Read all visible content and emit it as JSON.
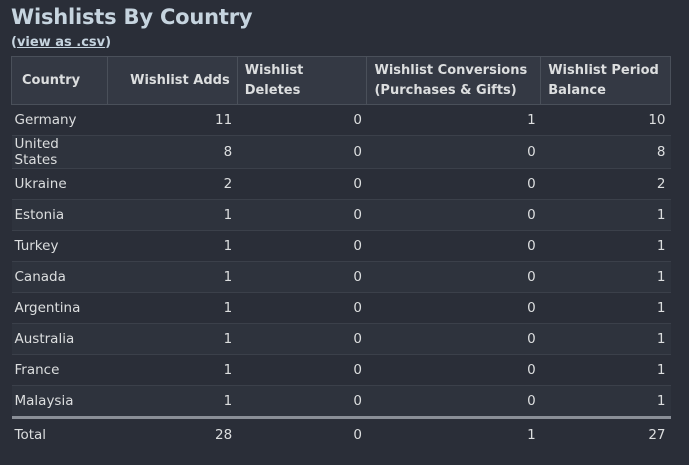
{
  "page": {
    "title": "Wishlists By Country",
    "csv_prefix": "(",
    "csv_link": "view as .csv",
    "csv_suffix": ")"
  },
  "table": {
    "headers": {
      "country": "Country",
      "adds": "Wishlist Adds",
      "deletes": "Wishlist Deletes",
      "conversions_line1": "Wishlist Conversions",
      "conversions_line2": "(Purchases & Gifts)",
      "balance_line1": "Wishlist Period",
      "balance_line2": "Balance"
    },
    "rows": [
      {
        "country": "Germany",
        "adds": "11",
        "deletes": "0",
        "conversions": "1",
        "balance": "10"
      },
      {
        "country": "United States",
        "adds": "8",
        "deletes": "0",
        "conversions": "0",
        "balance": "8"
      },
      {
        "country": "Ukraine",
        "adds": "2",
        "deletes": "0",
        "conversions": "0",
        "balance": "2"
      },
      {
        "country": "Estonia",
        "adds": "1",
        "deletes": "0",
        "conversions": "0",
        "balance": "1"
      },
      {
        "country": "Turkey",
        "adds": "1",
        "deletes": "0",
        "conversions": "0",
        "balance": "1"
      },
      {
        "country": "Canada",
        "adds": "1",
        "deletes": "0",
        "conversions": "0",
        "balance": "1"
      },
      {
        "country": "Argentina",
        "adds": "1",
        "deletes": "0",
        "conversions": "0",
        "balance": "1"
      },
      {
        "country": "Australia",
        "adds": "1",
        "deletes": "0",
        "conversions": "0",
        "balance": "1"
      },
      {
        "country": "France",
        "adds": "1",
        "deletes": "0",
        "conversions": "0",
        "balance": "1"
      },
      {
        "country": "Malaysia",
        "adds": "1",
        "deletes": "0",
        "conversions": "0",
        "balance": "1"
      }
    ],
    "total": {
      "label": "Total",
      "adds": "28",
      "deletes": "0",
      "conversions": "1",
      "balance": "27"
    }
  }
}
